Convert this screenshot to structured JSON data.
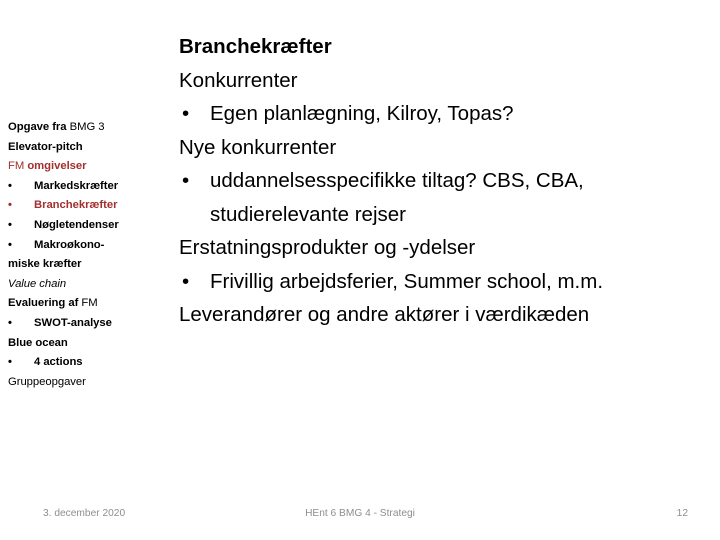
{
  "slide": {
    "background_color": "#FFFFFF",
    "accent_color": "#A32F2F",
    "text_color": "#000000",
    "footer_color": "#8E8E8E"
  },
  "sidebar": {
    "items": [
      {
        "id": "opgave",
        "bold_part": "Opgave fra ",
        "regular_part": "BMG 3",
        "type": "line",
        "color": "black"
      },
      {
        "id": "elevator-pitch",
        "text": "Elevator-pitch",
        "type": "line",
        "color": "black",
        "bold": true
      },
      {
        "id": "fm-omgivelser",
        "regular_part": "FM ",
        "bold_part": "omgivelser",
        "type": "line",
        "color": "red"
      },
      {
        "id": "markedskraefter",
        "text": "Markedskræfter",
        "type": "bullet",
        "color": "black",
        "bullet": "•"
      },
      {
        "id": "branchekraefter",
        "text": "Branchekræfter",
        "type": "bullet",
        "color": "red",
        "bullet": "•"
      },
      {
        "id": "nogletendenser",
        "text": "Nøgletendenser",
        "type": "bullet",
        "color": "black",
        "bullet": "•"
      },
      {
        "id": "makrookonomiske",
        "text": "Makroøkono-",
        "type": "bullet",
        "color": "black",
        "bullet": "•"
      },
      {
        "id": "miske-kraefter",
        "text": "miske kræfter",
        "type": "line",
        "color": "black",
        "bold": true
      },
      {
        "id": "value-chain",
        "text": "Value chain",
        "type": "line",
        "color": "black",
        "italic": true
      },
      {
        "id": "evaluering-af-fm",
        "bold_part": "Evaluering af ",
        "regular_part": "FM",
        "type": "line",
        "color": "black"
      },
      {
        "id": "swot-analyse",
        "text": "SWOT-analyse",
        "type": "bullet",
        "color": "black",
        "bullet": "•"
      },
      {
        "id": "blue-ocean",
        "text": "Blue ocean",
        "type": "line",
        "color": "black",
        "bold": true
      },
      {
        "id": "4-actions",
        "text": "4 actions",
        "type": "bullet",
        "color": "black",
        "bullet": "•"
      },
      {
        "id": "gruppeopgaver",
        "text": "Gruppeopgaver",
        "type": "line",
        "color": "black"
      }
    ]
  },
  "main": {
    "title": "Branchekræfter",
    "blocks": [
      {
        "id": "konkurrenter-head",
        "text": "Konkurrenter",
        "kind": "heading"
      },
      {
        "id": "konkurrenter-bullet",
        "text": "Egen planlægning, Kilroy, Topas?",
        "kind": "bullet",
        "bullet": "•"
      },
      {
        "id": "nye-konkurrenter-head",
        "text": "Nye konkurrenter",
        "kind": "heading"
      },
      {
        "id": "nye-konkurrenter-b1",
        "text": "uddannelsesspecifikke tiltag? CBS, CBA,",
        "kind": "bullet",
        "bullet": "•",
        "cont": "studierelevante rejser"
      },
      {
        "id": "erstatning-head",
        "text": "Erstatningsprodukter og -ydelser",
        "kind": "heading"
      },
      {
        "id": "erstatning-bullet",
        "text": "Frivillig arbejdsferier, Summer school, m.m.",
        "kind": "bullet",
        "bullet": "•"
      },
      {
        "id": "leverandorer-head",
        "text": "Leverandører og andre aktører i værdikæden",
        "kind": "heading"
      }
    ]
  },
  "footer": {
    "date": "3. december 2020",
    "center": "HEnt 6 BMG 4 - Strategi",
    "page_number": "12"
  }
}
